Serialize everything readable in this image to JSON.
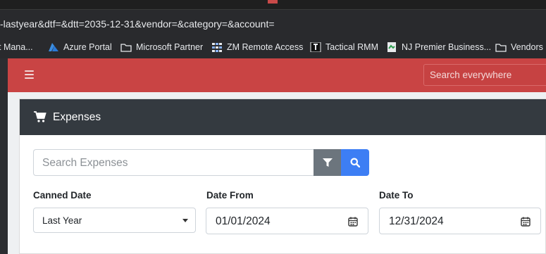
{
  "browser": {
    "url": "-lastyear&dtf=&dtt=2035-12-31&vendor=&category=&account=",
    "bookmarks": [
      {
        "label": "t Mana...",
        "icon": "none"
      },
      {
        "label": "Azure Portal",
        "icon": "azure-icon"
      },
      {
        "label": "Microsoft Partner",
        "icon": "folder-icon"
      },
      {
        "label": "ZM Remote Access",
        "icon": "grid-icon"
      },
      {
        "label": "Tactical RMM",
        "icon": "tactical-icon"
      },
      {
        "label": "NJ Premier Business...",
        "icon": "page-icon"
      },
      {
        "label": "Vendors",
        "icon": "folder-icon"
      }
    ]
  },
  "header": {
    "search_placeholder": "Search everywhere",
    "accent_color": "#c94444"
  },
  "card": {
    "title": "Expenses",
    "search_placeholder": "Search Expenses"
  },
  "filters": {
    "canned_label": "Canned Date",
    "canned_value": "Last Year",
    "from_label": "Date From",
    "from_value": "01/01/2024",
    "to_label": "Date To",
    "to_value": "12/31/2024"
  }
}
